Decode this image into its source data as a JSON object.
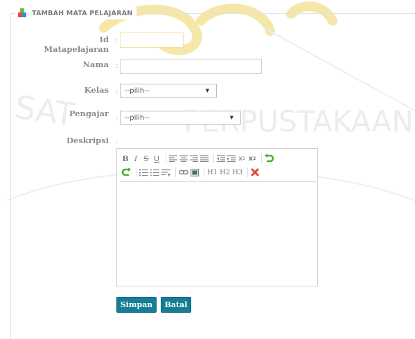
{
  "watermark": {
    "text": "SAT PERPUSTAKAAN"
  },
  "form": {
    "title": "TAMBAH MATA PELAJARAN",
    "fields": {
      "id": {
        "label": "Id Matapelajaran",
        "value": ""
      },
      "nama": {
        "label": "Nama",
        "value": ""
      },
      "kelas": {
        "label": "Kelas",
        "selected": "--pilih--"
      },
      "pengajar": {
        "label": "Pengajar",
        "selected": "--pilih--"
      },
      "deskripsi": {
        "label": "Deskripsi"
      }
    },
    "colon": ":",
    "toolbar": {
      "bold": "B",
      "italic": "I",
      "strike": "S",
      "underline": "U",
      "subscript": "x",
      "superscript": "x",
      "h1": "H1",
      "h2": "H2",
      "h3": "H3"
    },
    "buttons": {
      "save": "Simpan",
      "cancel": "Batal"
    }
  },
  "colors": {
    "button": "#167d96",
    "watermark": "#e8c94a"
  }
}
